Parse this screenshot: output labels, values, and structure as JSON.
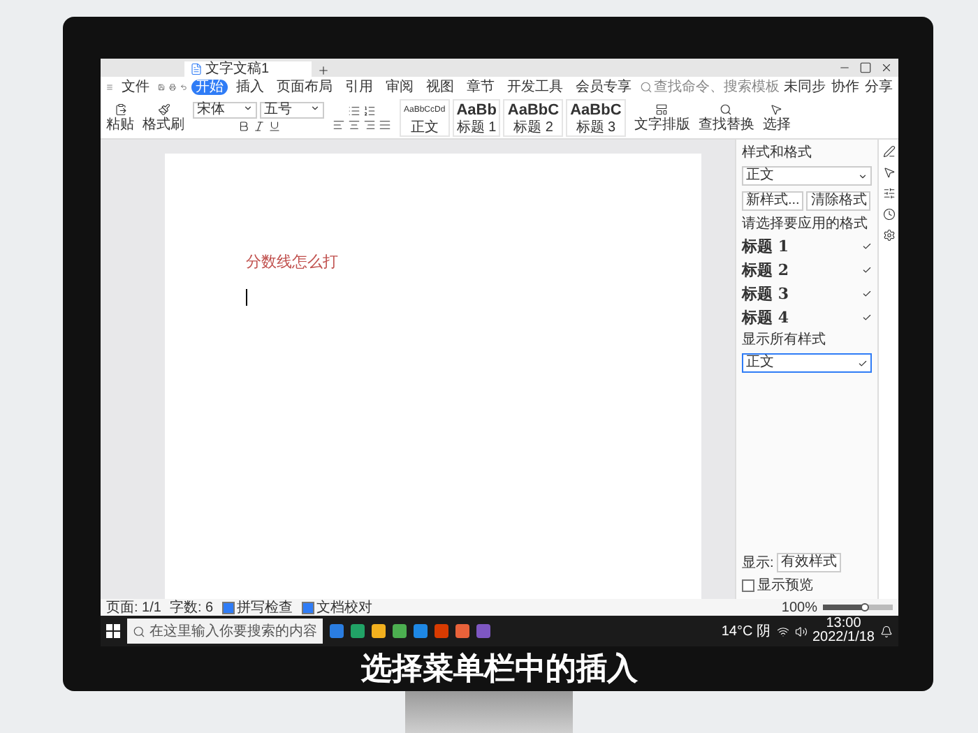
{
  "tabs": [
    {
      "label": "文字文稿1",
      "selected": true
    }
  ],
  "menu": [
    {
      "label": "文件",
      "selected": false
    },
    {
      "label": "开始",
      "selected": true
    },
    {
      "label": "插入",
      "selected": false
    },
    {
      "label": "页面布局",
      "selected": false
    },
    {
      "label": "引用",
      "selected": false
    },
    {
      "label": "审阅",
      "selected": false
    },
    {
      "label": "视图",
      "selected": false
    },
    {
      "label": "章节",
      "selected": false
    },
    {
      "label": "开发工具",
      "selected": false
    },
    {
      "label": "会员专享",
      "selected": false
    }
  ],
  "search": {
    "placeholder": "查找命令、搜索模板"
  },
  "account_actions": [
    "未同步",
    "协作",
    "分享"
  ],
  "ribbon": {
    "clipboard": [
      "粘贴",
      "格式刷"
    ],
    "font": "宋体",
    "size": "五号",
    "styles": [
      {
        "sample": "AaBbCcDd",
        "name": "正文"
      },
      {
        "sample": "AaBb",
        "name": "标题 1"
      },
      {
        "sample": "AaBbC",
        "name": "标题 2"
      },
      {
        "sample": "AaBbC",
        "name": "标题 3"
      }
    ],
    "tools": [
      "文字排版",
      "查找替换",
      "选择"
    ]
  },
  "document": {
    "heading": "分数线怎么打"
  },
  "style_panel": {
    "title": "样式和格式",
    "current": "正文",
    "buttons": [
      "新样式...",
      "清除格式"
    ],
    "prompt": "请选择要应用的格式",
    "styles": [
      "标题 1",
      "标题 2",
      "标题 3",
      "标题 4"
    ],
    "note": "显示所有样式",
    "applied": "正文",
    "show_label": "显示:",
    "show_value": "有效样式",
    "preview": {
      "label": "显示预览",
      "checked": false
    }
  },
  "status_bar": {
    "page": "页面: 1/1",
    "words": "字数: 6",
    "checks": [
      {
        "label": "拼写检查",
        "checked": true
      },
      {
        "label": "文档校对",
        "checked": true
      }
    ],
    "zoom": "100%",
    "zoom_slider": {
      "level": 0.6
    }
  },
  "taskbar": {
    "search_placeholder": "在这里输入你要搜索的内容",
    "weather": "14°C 阴",
    "time": "13:00",
    "date": "2022/1/18"
  },
  "subtitle": "选择菜单栏中的插入"
}
